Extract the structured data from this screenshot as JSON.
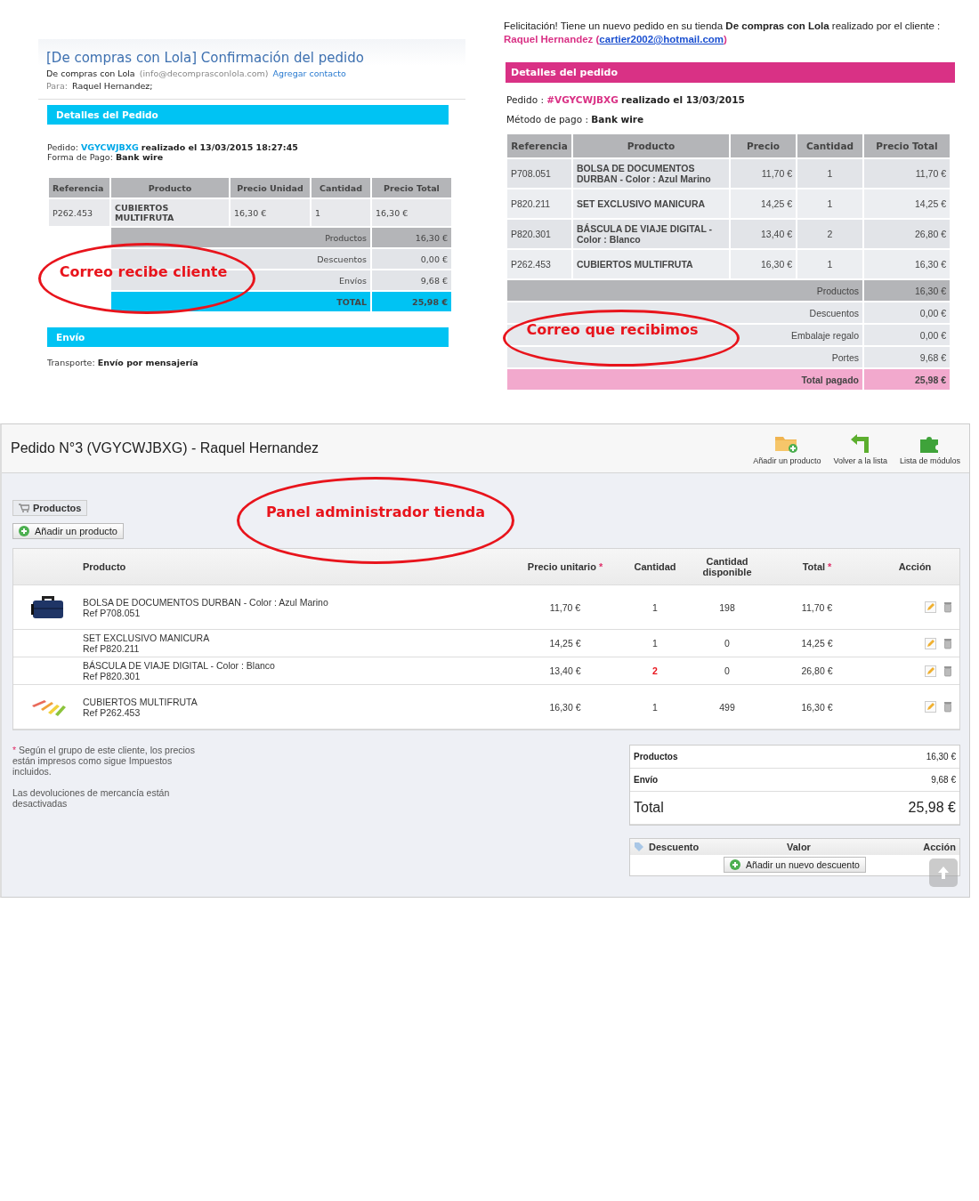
{
  "customer_email": {
    "subject": "[De compras con Lola] Confirmación del pedido",
    "sender_name": "De compras con Lola",
    "sender_email": "(info@decomprasconlola.com)",
    "add_contact": "Agregar contacto",
    "to_label": "Para:",
    "to_value": "Raquel Hernandez;",
    "section_title": "Detalles del Pedido",
    "order_label": "Pedido:",
    "order_ref": "VGYCWJBXG",
    "order_date": "realizado el 13/03/2015 18:27:45",
    "payment_label": "Forma de Pago:",
    "payment_value": "Bank wire",
    "columns": [
      "Referencia",
      "Producto",
      "Precio Unidad",
      "Cantidad",
      "Precio Total"
    ],
    "rows": [
      {
        "ref": "P262.453",
        "product": "CUBIERTOS MULTIFRUTA",
        "price": "16,30 €",
        "qty": "1",
        "total": "16,30 €"
      }
    ],
    "totals": [
      {
        "kind": "subtotal",
        "label": "Productos",
        "value": "16,30 €"
      },
      {
        "kind": "line",
        "label": "Descuentos",
        "value": "0,00 €"
      },
      {
        "kind": "line",
        "label": "Envíos",
        "value": "9,68 €"
      },
      {
        "kind": "total",
        "label": "TOTAL",
        "value": "25,98 €"
      }
    ],
    "shipping_title": "Envío",
    "transport_label": "Transporte:",
    "transport_value": "Envío por mensajería"
  },
  "shop_email": {
    "intro": "Felicitación! Tiene un nuevo pedido en su tienda **De compras con Lola** realizado por el cliente :",
    "customer_name": "Raquel Hernandez (",
    "customer_email": "cartier2002@hotmail.com",
    "customer_close": ")",
    "section_title": "Detalles del pedido",
    "order_label": "Pedido :",
    "order_ref": "#VGYCWJBXG",
    "order_date": "realizado el 13/03/2015",
    "payment_label": "Método de pago :",
    "payment_value": "Bank wire",
    "columns": [
      "Referencia",
      "Producto",
      "Precio",
      "Cantidad",
      "Precio Total"
    ],
    "rows": [
      {
        "ref": "P708.051",
        "product": "BOLSA DE DOCUMENTOS DURBAN - Color : Azul Marino",
        "price": "11,70 €",
        "qty": "1",
        "total": "11,70 €"
      },
      {
        "ref": "P820.211",
        "product": "SET EXCLUSIVO MANICURA",
        "price": "14,25 €",
        "qty": "1",
        "total": "14,25 €"
      },
      {
        "ref": "P820.301",
        "product": "BÁSCULA DE VIAJE DIGITAL - Color : Blanco",
        "price": "13,40 €",
        "qty": "2",
        "total": "26,80 €"
      },
      {
        "ref": "P262.453",
        "product": "CUBIERTOS MULTIFRUTA",
        "price": "16,30 €",
        "qty": "1",
        "total": "16,30 €"
      }
    ],
    "totals": [
      {
        "kind": "subtotal",
        "label": "Productos",
        "value": "16,30 €"
      },
      {
        "kind": "line",
        "label": "Descuentos",
        "value": "0,00 €"
      },
      {
        "kind": "line",
        "label": "Embalaje regalo",
        "value": "0,00 €"
      },
      {
        "kind": "line",
        "label": "Portes",
        "value": "9,68 €"
      },
      {
        "kind": "total",
        "label": "Total pagado",
        "value": "25,98 €"
      }
    ]
  },
  "admin": {
    "title": "Pedido N°3 (VGYCWJBXG) - Raquel Hernandez",
    "toolbar": [
      {
        "kind": "add",
        "label": "Añadir un producto"
      },
      {
        "kind": "back",
        "label": "Volver a la lista"
      },
      {
        "kind": "modules",
        "label": "Lista de módulos"
      }
    ],
    "products_tab": "Productos",
    "add_product": "Añadir un producto",
    "columns": [
      {
        "label": "Producto"
      },
      {
        "label": "Precio unitario",
        "mark": "*"
      },
      {
        "label": "Cantidad"
      },
      {
        "label": "Cantidad disponible"
      },
      {
        "label": "Total",
        "mark": "*"
      },
      {
        "label": "Acción"
      }
    ],
    "rows": [
      {
        "name": "BOLSA DE DOCUMENTOS DURBAN - Color : Azul Marino",
        "ref": "Ref P708.051",
        "price": "11,70 €",
        "qty": "1",
        "highlight": false,
        "available": "198",
        "total": "11,70 €"
      },
      {
        "name": "SET EXCLUSIVO MANICURA",
        "ref": "Ref P820.211",
        "price": "14,25 €",
        "qty": "1",
        "highlight": false,
        "available": "0",
        "total": "14,25 €"
      },
      {
        "name": "BÁSCULA DE VIAJE DIGITAL - Color : Blanco",
        "ref": "Ref P820.301",
        "price": "13,40 €",
        "qty": "2",
        "highlight": true,
        "available": "0",
        "total": "26,80 €"
      },
      {
        "name": "CUBIERTOS MULTIFRUTA",
        "ref": "Ref P262.453",
        "price": "16,30 €",
        "qty": "1",
        "highlight": false,
        "available": "499",
        "total": "16,30 €"
      }
    ],
    "notes": [
      {
        "mark": "*",
        "text": "Según el grupo de este cliente, los precios están impresos como sigue Impuestos incluidos."
      },
      {
        "text": "Las devoluciones de mercancía están desactivadas"
      }
    ],
    "summary": [
      {
        "kind": "line",
        "label": "Productos",
        "value": "16,30 €"
      },
      {
        "kind": "line",
        "label": "Envío",
        "value": "9,68 €"
      },
      {
        "kind": "total",
        "label": "Total",
        "value": "25,98 €"
      }
    ],
    "discount": {
      "columns": [
        "Descuento",
        "Valor",
        "Acción"
      ],
      "add_button": "Añadir un nuevo descuento"
    }
  },
  "annotations": [
    "Correo recibe cliente",
    "Correo que recibimos",
    "Panel administrador tienda"
  ]
}
